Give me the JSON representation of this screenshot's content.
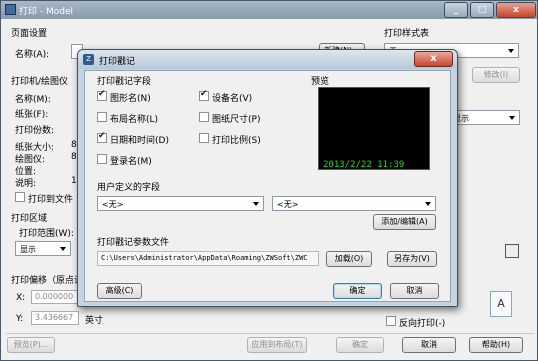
{
  "background_window": {
    "title": "打印 - Model",
    "page_setup": {
      "group": "页面设置",
      "name_label": "名称(A):",
      "add_button": "新建(N)..."
    },
    "printer_group": "打印机/绘图仪",
    "printer_labels": {
      "name": "名称(M):",
      "paper": "纸张(F):",
      "copies": "打印份数:",
      "paper_size": "纸张大小:",
      "plotter": "绘图仪:",
      "location": "位置:",
      "description": "说明:"
    },
    "printer_values": {
      "paper_size": "8",
      "plotter": "8",
      "description": "1"
    },
    "print_to_file": "打印到文件",
    "print_area": {
      "group": "打印区域",
      "range_label": "打印范围(W):",
      "range_value": "显示"
    },
    "print_offset": {
      "group": "打印偏移（原点设置",
      "x_label": "X:",
      "x_value": "0.000000",
      "y_label": "Y:",
      "y_value": "3.436667",
      "unit": "英寸"
    },
    "style_table": {
      "group": "打印样式表",
      "value": "无",
      "modify_button": "修改(I)"
    },
    "right_misc": {
      "display_value": "显示"
    },
    "reverse_print": "反向打印(-)",
    "bottom_buttons": {
      "preview": "预览(P)...",
      "apply_layout": "应用到布局(T)",
      "ok": "确定",
      "cancel": "取消",
      "help": "帮助(H)"
    }
  },
  "dialog": {
    "title": "打印戳记",
    "close_glyph": "x",
    "fields_group": "打印戳记字段",
    "fields": [
      {
        "label": "图形名(N)",
        "checked": true
      },
      {
        "label": "设备名(V)",
        "checked": true
      },
      {
        "label": "布局名称(L)",
        "checked": false
      },
      {
        "label": "图纸尺寸(P)",
        "checked": false
      },
      {
        "label": "日期和时间(D)",
        "checked": true
      },
      {
        "label": "打印比例(S)",
        "checked": false
      },
      {
        "label": "登录名(M)",
        "checked": false
      }
    ],
    "preview_label": "预览",
    "preview_stamp": "2013/2/22 11:39",
    "user_fields_group": "用户定义的字段",
    "user_field_1": "<无>",
    "user_field_2": "<无>",
    "add_edit_button": "添加/编辑(A)",
    "param_file_group": "打印戳记参数文件",
    "param_file_path": "C:\\Users\\Administrator\\AppData\\Roaming\\ZWSoft\\ZWC",
    "load_button": "加载(O)",
    "save_as_button": "另存为(V)",
    "advanced_button": "高级(C)",
    "ok_button": "确定",
    "cancel_button": "取消"
  },
  "colors": {
    "stamp_text": "#20e020",
    "preview_bg": "#000000",
    "dialog_frame": "#c6d3e0"
  }
}
